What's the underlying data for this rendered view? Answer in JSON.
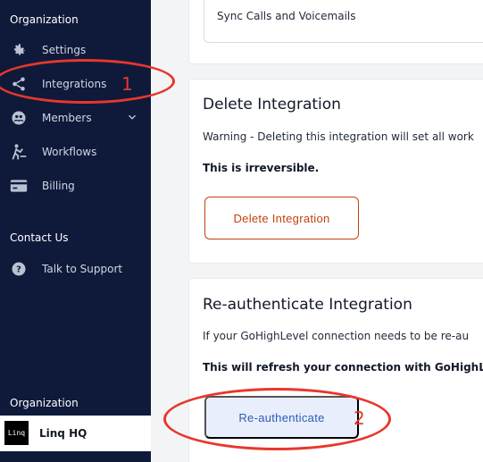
{
  "sidebar": {
    "section_org": "Organization",
    "items": [
      {
        "label": "Settings",
        "icon": "gear-icon"
      },
      {
        "label": "Integrations",
        "icon": "share-icon"
      },
      {
        "label": "Members",
        "icon": "members-icon"
      },
      {
        "label": "Workflows",
        "icon": "workflow-icon"
      },
      {
        "label": "Billing",
        "icon": "card-icon"
      }
    ],
    "section_contact": "Contact Us",
    "support_label": "Talk to Support",
    "section_org_bottom": "Organization",
    "org_logo_text": "Linq",
    "org_name": "Linq HQ"
  },
  "main": {
    "sync_text": "Sync Calls and Voicemails",
    "delete": {
      "title": "Delete Integration",
      "warning": "Warning - Deleting this integration will set all work",
      "irreversible": "This is irreversible.",
      "button": "Delete Integration"
    },
    "reauth": {
      "title": "Re-authenticate Integration",
      "desc": "If your GoHighLevel connection needs to be re-au",
      "bold": "This will refresh your connection with GoHighLev",
      "button": "Re-authenticate"
    }
  },
  "annotations": {
    "one": "1",
    "two": "2",
    "color": "#e8372b"
  },
  "colors": {
    "sidebar": "#0f1a3a",
    "danger": "#c2410c",
    "primary": "#2d5db5"
  }
}
